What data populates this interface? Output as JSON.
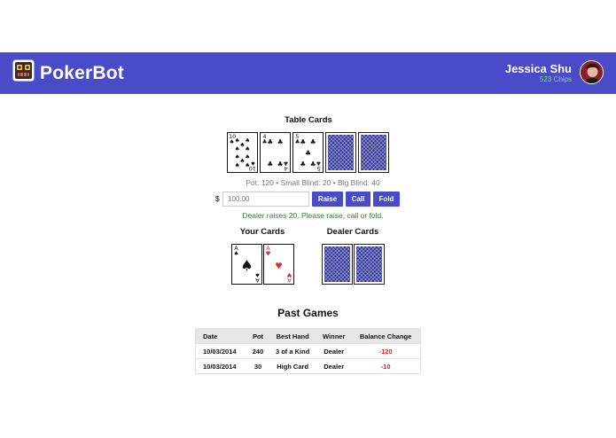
{
  "app": {
    "brand": "PokerBot",
    "logo_icon": "robot-icon",
    "accent_color": "#4a4bc9"
  },
  "user": {
    "name": "Jessica Shu",
    "chips": "523 Chips",
    "avatar_icon": "avatar-photo"
  },
  "table": {
    "title": "Table Cards",
    "cards": [
      {
        "rank": "10",
        "suit": "spades",
        "symbol": "♠",
        "face_up": true
      },
      {
        "rank": "4",
        "suit": "clubs",
        "symbol": "♣",
        "face_up": true
      },
      {
        "rank": "5",
        "suit": "clubs",
        "symbol": "♣",
        "face_up": true
      },
      {
        "face_up": false
      },
      {
        "face_up": false
      }
    ],
    "pot_info": "Pot: 120 • Small Blind: 20 • Big Blind: 40"
  },
  "controls": {
    "currency_symbol": "$",
    "bet_placeholder": "100.00",
    "raise_label": "Raise",
    "call_label": "Call",
    "fold_label": "Fold"
  },
  "status_message": "Dealer raises 20. Please raise, call or fold.",
  "your_cards": {
    "title": "Your Cards",
    "cards": [
      {
        "rank": "A",
        "suit": "spades",
        "symbol": "♠",
        "face_up": true
      },
      {
        "rank": "A",
        "suit": "hearts",
        "symbol": "♥",
        "face_up": true
      }
    ]
  },
  "dealer_cards": {
    "title": "Dealer Cards",
    "cards": [
      {
        "face_up": false
      },
      {
        "face_up": false
      }
    ]
  },
  "past_games": {
    "title": "Past Games",
    "columns": [
      "Date",
      "Pot",
      "Best Hand",
      "Winner",
      "Balance Change"
    ],
    "rows": [
      [
        "10/03/2014",
        "240",
        "3 of a Kind",
        "Dealer",
        "-120"
      ],
      [
        "10/03/2014",
        "30",
        "High Card",
        "Dealer",
        "-10"
      ]
    ]
  }
}
